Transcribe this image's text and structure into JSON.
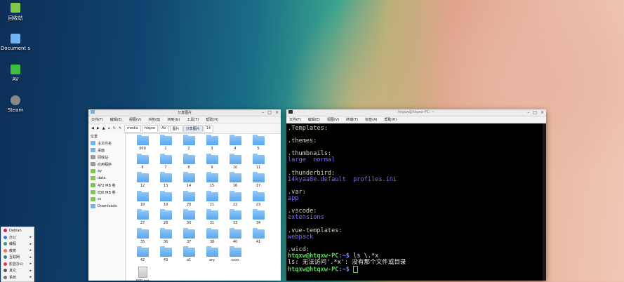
{
  "desktop": {
    "icons": [
      {
        "label": "回收站",
        "color": "#7cc94c"
      },
      {
        "label": "Document s",
        "color": "#6fb3f2"
      },
      {
        "label": "AV",
        "color": "#3fbf3f"
      },
      {
        "label": "Steam",
        "color": "#888888"
      }
    ]
  },
  "file_manager": {
    "title": "分享图片",
    "menus": [
      "文件(F)",
      "编辑(E)",
      "视图(V)",
      "书签(B)",
      "转到(G)",
      "工具(T)",
      "帮助(H)"
    ],
    "breadcrumbs": [
      "media",
      "htqxw",
      "AV",
      "图片",
      "分享图片",
      "14"
    ],
    "sidebar": [
      {
        "label": "位置",
        "header": true
      },
      {
        "label": "主文件夹",
        "color": "#6fb3f2"
      },
      {
        "label": "桌面",
        "color": "#6fb3f2"
      },
      {
        "label": "回收站",
        "color": "#999999"
      },
      {
        "label": "应用程序",
        "color": "#999999"
      },
      {
        "label": "ay",
        "color": "#7cc94c"
      },
      {
        "label": "data",
        "color": "#7cc94c"
      },
      {
        "label": "472 MB 卷",
        "color": "#7cc94c"
      },
      {
        "label": "836 MB 卷",
        "color": "#7cc94c"
      },
      {
        "label": "ss",
        "color": "#7cc94c"
      },
      {
        "label": "Downloads",
        "color": "#6fb3f2"
      }
    ],
    "folders": [
      "000",
      "1",
      "2",
      "3",
      "4",
      "5",
      "6",
      "7",
      "8",
      "9",
      "10",
      "11",
      "12",
      "13",
      "14",
      "15",
      "16",
      "17",
      "18",
      "19",
      "20",
      "21",
      "22",
      "23",
      "27",
      "28",
      "30",
      "31",
      "33",
      "34",
      "35",
      "36",
      "37",
      "38",
      "40",
      "41",
      "42",
      "43",
      "a1",
      "ary",
      "sxxs"
    ],
    "files": [
      "000.jpg"
    ]
  },
  "terminal": {
    "title": "htqxw@htqxw-PC: ~",
    "menus": [
      "文件(F)",
      "编辑(E)",
      "视图(V)",
      "终端(T)",
      "标签(A)",
      "帮助(H)"
    ],
    "lines": [
      {
        "text": ".Templates:",
        "color": "#d7d0c0"
      },
      {
        "text": "",
        "color": "#ffffff"
      },
      {
        "text": ".themes:",
        "color": "#d7d0c0"
      },
      {
        "text": "",
        "color": "#ffffff"
      },
      {
        "text": ".thumbnails:",
        "color": "#d7d0c0"
      },
      {
        "text": "large  normal",
        "color": "#7b6bff"
      },
      {
        "text": "",
        "color": "#ffffff"
      },
      {
        "text": ".thunderbird:",
        "color": "#d7d0c0"
      },
      {
        "text": "14kyaa8e.default  profiles.ini",
        "color": "#7b6bff"
      },
      {
        "text": "",
        "color": "#ffffff"
      },
      {
        "text": ".var:",
        "color": "#d7d0c0"
      },
      {
        "text": "app",
        "color": "#7b6bff"
      },
      {
        "text": "",
        "color": "#ffffff"
      },
      {
        "text": ".vscode:",
        "color": "#d7d0c0"
      },
      {
        "text": "extensions",
        "color": "#7b6bff"
      },
      {
        "text": "",
        "color": "#ffffff"
      },
      {
        "text": ".vue-templates:",
        "color": "#d7d0c0"
      },
      {
        "text": "webpack",
        "color": "#7b6bff"
      },
      {
        "text": "",
        "color": "#ffffff"
      },
      {
        "text": ".wicd:",
        "color": "#d7d0c0"
      }
    ],
    "prompt_user": "htqxw@htqxw-PC",
    "prompt_path": ":~$ ",
    "command": "ls \\.*x",
    "error": "ls: 无法访问'.*x': 没有那个文件或目录",
    "final_prompt_user": "htqxw@htqxw-PC",
    "final_prompt_path": ":~$ "
  },
  "start_menu": {
    "items": [
      {
        "label": "Debian",
        "color": "#d02050"
      },
      {
        "label": "办公",
        "color": "#3a7bd5"
      },
      {
        "label": "编程",
        "color": "#2a9d8f"
      },
      {
        "label": "教育",
        "color": "#e76f51"
      },
      {
        "label": "互联网",
        "color": "#457b9d"
      },
      {
        "label": "影音办公",
        "color": "#e63946"
      },
      {
        "label": "其它",
        "color": "#555555"
      },
      {
        "label": "系统",
        "color": "#6c757d"
      }
    ]
  }
}
